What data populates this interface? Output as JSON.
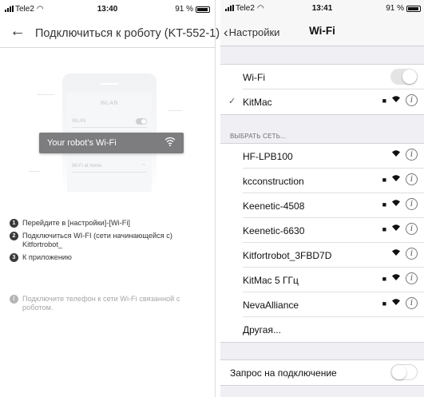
{
  "left": {
    "status": {
      "carrier": "Tele2",
      "time": "13:40",
      "battery": "91 %"
    },
    "header": {
      "back_icon": "arrow-left-icon",
      "title": "Подключиться к роботу (KT-552-1)"
    },
    "illustration": {
      "wlan_label": "WLAN",
      "row_wlan": "WLAN",
      "row_home": "Wi-Fi at home",
      "banner": "Your robot's Wi-Fi"
    },
    "steps": [
      {
        "num": "1",
        "text": "Перейдите в [настройки]-[Wi-Fi]"
      },
      {
        "num": "2",
        "text": "Подключиться WI-FI (сети начинающейся с) Kitfortrobot_"
      },
      {
        "num": "3",
        "text": "К приложению"
      }
    ],
    "note": {
      "icon": "!",
      "text": "Подключите телефон к сети Wi-Fi связанной с роботом."
    }
  },
  "right": {
    "status": {
      "carrier": "Tele2",
      "time": "13:41",
      "battery": "91 %"
    },
    "nav": {
      "back": "Настройки",
      "title": "Wi-Fi"
    },
    "wifi_row": {
      "label": "Wi-Fi",
      "enabled": true
    },
    "connected": {
      "name": "KitMac",
      "locked": true
    },
    "section_header": "ВЫБРАТЬ СЕТЬ...",
    "networks": [
      {
        "name": "HF-LPB100",
        "locked": false
      },
      {
        "name": "kcconstruction",
        "locked": true
      },
      {
        "name": "Keenetic-4508",
        "locked": true
      },
      {
        "name": "Keenetic-6630",
        "locked": true
      },
      {
        "name": "Kitfortrobot_3FBD7D",
        "locked": false
      },
      {
        "name": "KitMac 5 ГГц",
        "locked": true
      },
      {
        "name": "NevaAlliance",
        "locked": true
      }
    ],
    "other": "Другая...",
    "ask_join": {
      "label": "Запрос на подключение",
      "enabled": false
    },
    "glyphs": {
      "check": "✓",
      "info": "i",
      "wifi": "ᯤ",
      "lock": "🔒"
    }
  }
}
